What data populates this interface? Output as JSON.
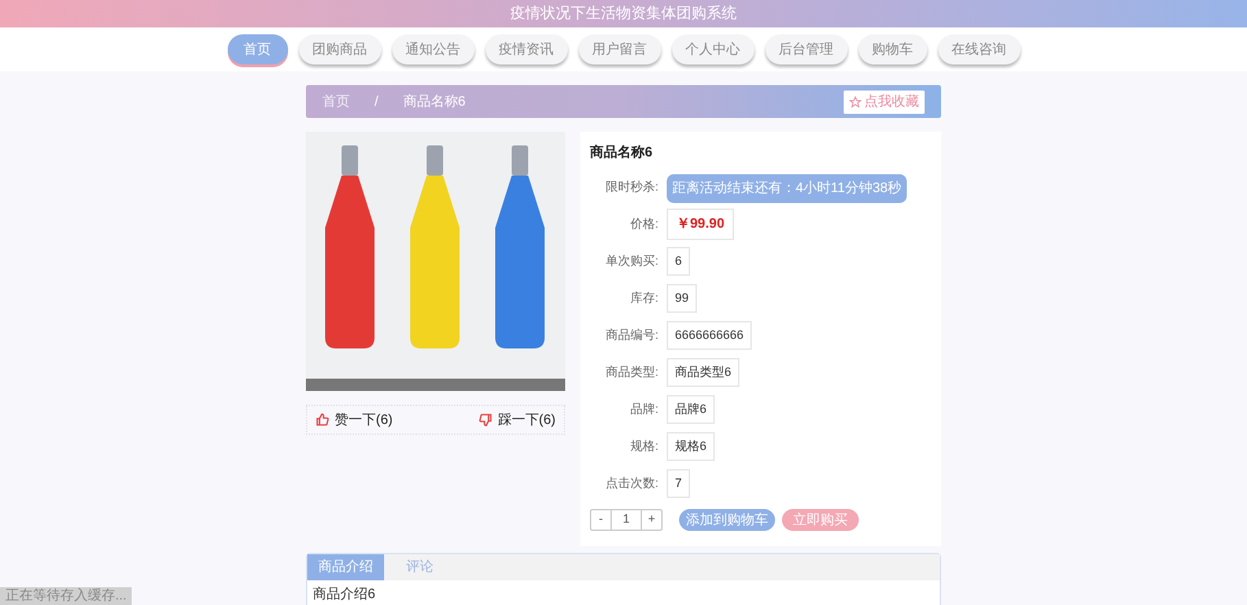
{
  "header": {
    "title": "疫情状况下生活物资集体团购系统"
  },
  "nav": [
    {
      "label": "首页",
      "selected": true
    },
    {
      "label": "团购商品",
      "selected": false
    },
    {
      "label": "通知公告",
      "selected": false
    },
    {
      "label": "疫情资讯",
      "selected": false
    },
    {
      "label": "用户留言",
      "selected": false
    },
    {
      "label": "个人中心",
      "selected": false
    },
    {
      "label": "后台管理",
      "selected": false
    },
    {
      "label": "购物车",
      "selected": false
    },
    {
      "label": "在线咨询",
      "selected": false
    }
  ],
  "breadcrumb": {
    "items": [
      "首页",
      "商品名称6"
    ],
    "separator": "/",
    "favorite_button": "点我收藏"
  },
  "votes": {
    "like": "赞一下(6)",
    "dislike": "踩一下(6)"
  },
  "product": {
    "name": "商品名称6",
    "countdown": {
      "label": "限时秒杀:",
      "value": "距离活动结束还有：4小时11分钟38秒"
    },
    "price": {
      "label": "价格:",
      "value": "￥99.90"
    },
    "fields": [
      {
        "label": "单次购买:",
        "value": "6"
      },
      {
        "label": "库存:",
        "value": "99"
      },
      {
        "label": "商品编号:",
        "value": "6666666666"
      },
      {
        "label": "商品类型:",
        "value": "商品类型6"
      },
      {
        "label": "品牌:",
        "value": "品牌6"
      },
      {
        "label": "规格:",
        "value": "规格6"
      },
      {
        "label": "点击次数:",
        "value": "7"
      }
    ],
    "quantity": {
      "minus": "-",
      "value": "1",
      "plus": "+"
    },
    "add_to_cart": "添加到购物车",
    "buy_now": "立即购买"
  },
  "detail_tabs": [
    {
      "label": "商品介绍",
      "selected": true
    },
    {
      "label": "评论",
      "selected": false
    }
  ],
  "detail_text": "商品介绍6",
  "status_bubble": "正在等待存入缓存..."
}
